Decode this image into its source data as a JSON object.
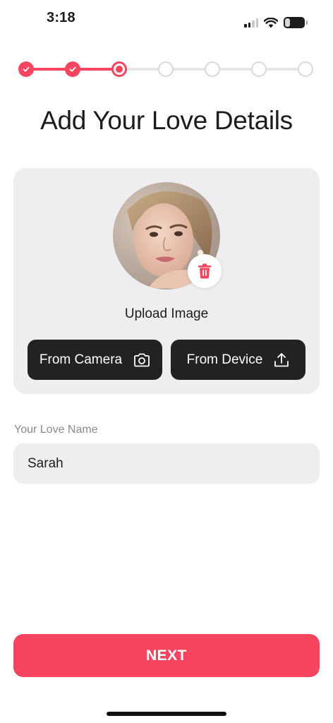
{
  "status_bar": {
    "time": "3:18",
    "battery_level": "22",
    "icons": [
      "signal-icon",
      "wifi-icon",
      "battery-icon"
    ]
  },
  "stepper": {
    "total_steps": 7,
    "completed_steps": 2,
    "current_step": 3,
    "accent_color": "#f7455f"
  },
  "page": {
    "title": "Add Your Love Details"
  },
  "upload": {
    "label": "Upload Image",
    "from_camera_label": "From Camera",
    "from_device_label": "From Device",
    "icons": [
      "trash-icon",
      "camera-icon",
      "upload-icon"
    ]
  },
  "name_field": {
    "label": "Your Love Name",
    "value": "Sarah"
  },
  "actions": {
    "next_label": "NEXT"
  },
  "colors": {
    "accent": "#f7455f",
    "dark_button": "#222224",
    "card_bg": "#eeeef0"
  }
}
